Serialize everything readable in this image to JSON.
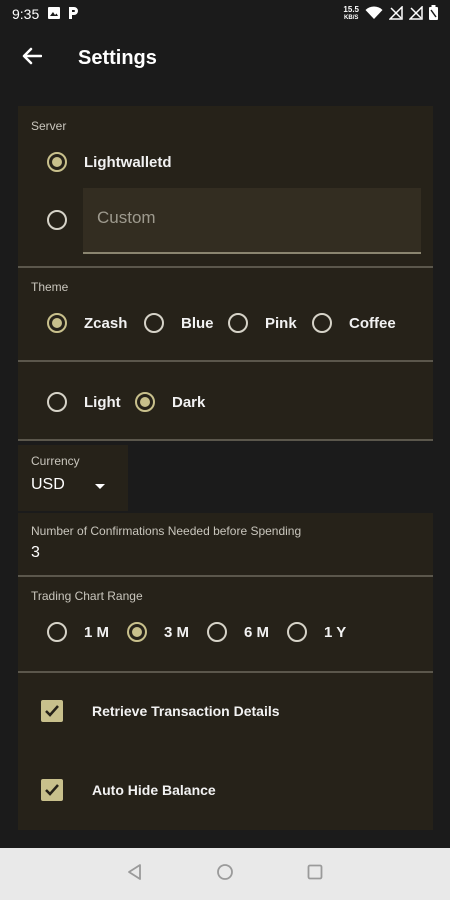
{
  "status_bar": {
    "time": "9:35",
    "speed_value": "15.5",
    "speed_unit": "KB/S",
    "icons": [
      "image-icon",
      "p-icon",
      "wifi-icon",
      "no-signal-icon",
      "no-signal-icon",
      "battery-icon"
    ]
  },
  "app_bar": {
    "title": "Settings",
    "back_icon": "arrow-back-icon"
  },
  "server": {
    "label": "Server",
    "options": [
      {
        "label": "Lightwalletd",
        "selected": true
      }
    ],
    "custom_placeholder": "Custom",
    "custom_selected": false
  },
  "theme": {
    "label": "Theme",
    "options": [
      {
        "label": "Zcash",
        "selected": true
      },
      {
        "label": "Blue",
        "selected": false
      },
      {
        "label": "Pink",
        "selected": false
      },
      {
        "label": "Coffee",
        "selected": false
      }
    ],
    "modes": [
      {
        "label": "Light",
        "selected": false
      },
      {
        "label": "Dark",
        "selected": true
      }
    ]
  },
  "currency": {
    "label": "Currency",
    "value": "USD"
  },
  "confirmations": {
    "label": "Number of Confirmations Needed before Spending",
    "value": "3"
  },
  "chart_range": {
    "label": "Trading Chart Range",
    "options": [
      {
        "label": "1 M",
        "selected": false
      },
      {
        "label": "3 M",
        "selected": true
      },
      {
        "label": "6 M",
        "selected": false
      },
      {
        "label": "1 Y",
        "selected": false
      }
    ]
  },
  "toggles": [
    {
      "label": "Retrieve Transaction Details",
      "checked": true
    },
    {
      "label": "Auto Hide Balance",
      "checked": true
    }
  ],
  "colors": {
    "accent": "#c8c08c",
    "card": "#262219",
    "background": "#1b1b1b"
  }
}
